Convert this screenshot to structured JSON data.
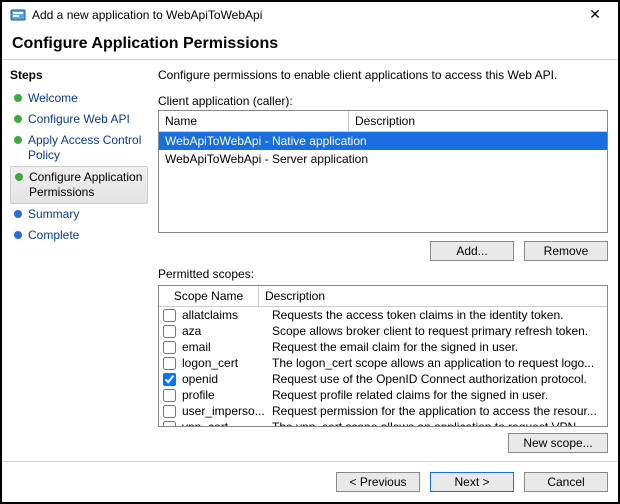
{
  "window": {
    "title": "Add a new application to WebApiToWebApi",
    "close_glyph": "✕"
  },
  "header": "Configure Application Permissions",
  "stepsTitle": "Steps",
  "steps": [
    {
      "label": "Welcome",
      "state": "done",
      "current": false
    },
    {
      "label": "Configure Web API",
      "state": "done",
      "current": false
    },
    {
      "label": "Apply Access Control Policy",
      "state": "done",
      "current": false
    },
    {
      "label": "Configure Application Permissions",
      "state": "done",
      "current": true
    },
    {
      "label": "Summary",
      "state": "pending",
      "current": false
    },
    {
      "label": "Complete",
      "state": "pending",
      "current": false
    }
  ],
  "content": {
    "instruction": "Configure permissions to enable client applications to access this Web API.",
    "clientLabel": "Client application (caller):",
    "clientColumns": {
      "name": "Name",
      "description": "Description"
    },
    "clients": [
      {
        "label": "WebApiToWebApi - Native application",
        "selected": true
      },
      {
        "label": "WebApiToWebApi - Server application",
        "selected": false
      }
    ],
    "buttons": {
      "add": "Add...",
      "remove": "Remove",
      "newScope": "New scope..."
    },
    "scopesLabel": "Permitted scopes:",
    "scopeColumns": {
      "name": "Scope Name",
      "description": "Description"
    },
    "scopes": [
      {
        "name": "allatclaims",
        "checked": false,
        "desc": "Requests the access token claims in the identity token."
      },
      {
        "name": "aza",
        "checked": false,
        "desc": "Scope allows broker client to request primary refresh token."
      },
      {
        "name": "email",
        "checked": false,
        "desc": "Request the email claim for the signed in user."
      },
      {
        "name": "logon_cert",
        "checked": false,
        "desc": "The logon_cert scope allows an application to request logo..."
      },
      {
        "name": "openid",
        "checked": true,
        "desc": "Request use of the OpenID Connect authorization protocol."
      },
      {
        "name": "profile",
        "checked": false,
        "desc": "Request profile related claims for the signed in user."
      },
      {
        "name": "user_imperso...",
        "checked": false,
        "desc": "Request permission for the application to access the resour..."
      },
      {
        "name": "vpn_cert",
        "checked": false,
        "desc": "The vpn_cert scope allows an application to request VPN ..."
      }
    ]
  },
  "footer": {
    "previous": "< Previous",
    "next": "Next >",
    "cancel": "Cancel"
  }
}
